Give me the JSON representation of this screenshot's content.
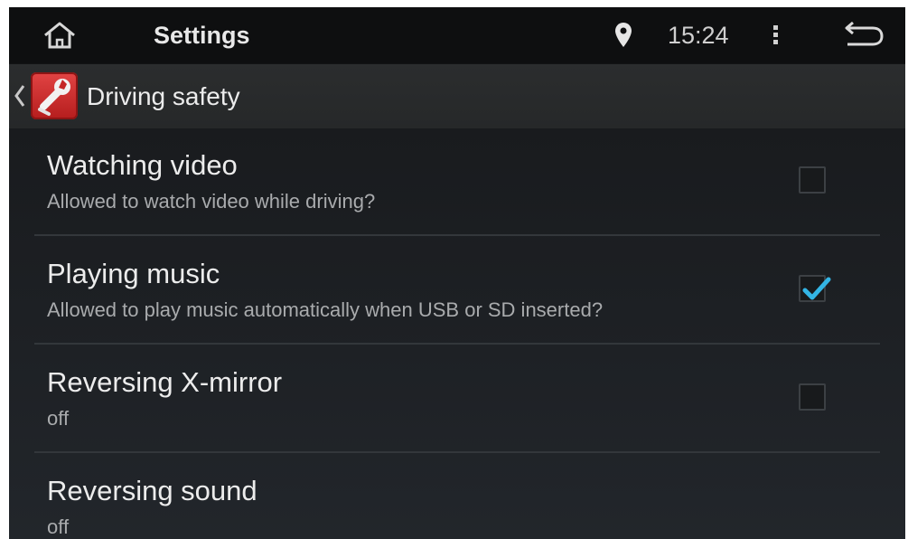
{
  "statusbar": {
    "title": "Settings",
    "time": "15:24",
    "icons": [
      "home-icon",
      "location-pin-icon",
      "overflow-menu-icon",
      "back-arrow-icon"
    ]
  },
  "actionbar": {
    "label": "Driving safety",
    "icon": "wrench-settings-icon"
  },
  "settings": [
    {
      "title": "Watching video",
      "subtitle": "Allowed to watch video while driving?",
      "checked": false,
      "has_checkbox": true
    },
    {
      "title": "Playing music",
      "subtitle": "Allowed to play music automatically when USB or SD inserted?",
      "checked": true,
      "has_checkbox": true
    },
    {
      "title": "Reversing X-mirror",
      "subtitle": "off",
      "checked": false,
      "has_checkbox": true
    },
    {
      "title": "Reversing sound",
      "subtitle": "off",
      "has_checkbox": false
    }
  ],
  "colors": {
    "accent": "#33b5e5",
    "background": "#1b1d20",
    "statusbar": "#0e0f10",
    "app_icon": "#d32f2f"
  }
}
